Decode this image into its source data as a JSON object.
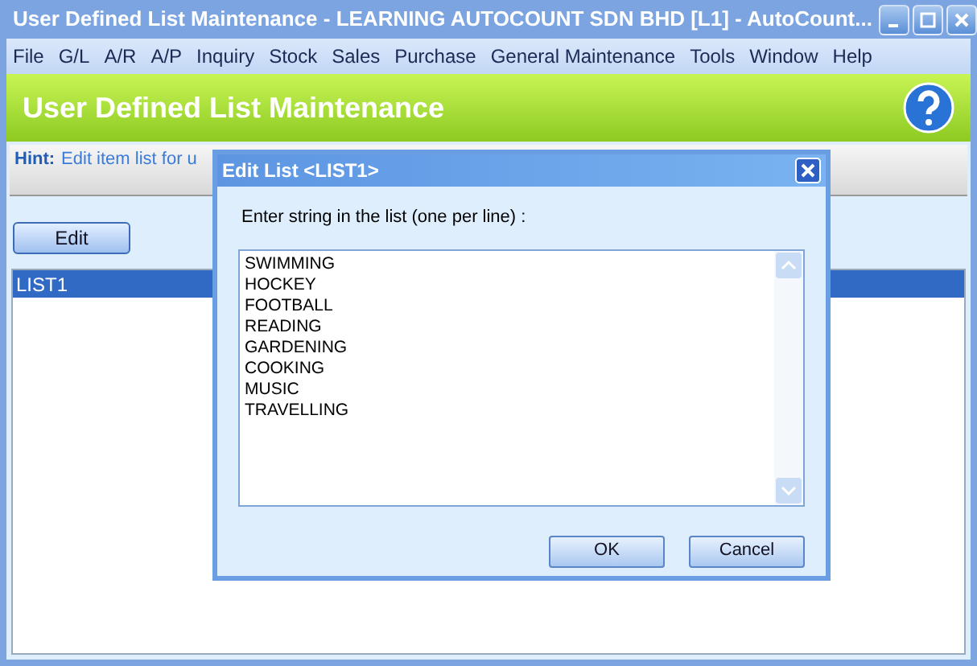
{
  "window": {
    "title": "User Defined List Maintenance - LEARNING AUTOCOUNT SDN BHD [L1] - AutoCount..."
  },
  "menu": [
    "File",
    "G/L",
    "A/R",
    "A/P",
    "Inquiry",
    "Stock",
    "Sales",
    "Purchase",
    "General Maintenance",
    "Tools",
    "Window",
    "Help"
  ],
  "header": {
    "title": "User Defined List Maintenance"
  },
  "hint": {
    "label": "Hint:",
    "text": "Edit item list for u"
  },
  "edit_button": "Edit",
  "lists": [
    {
      "name": "LIST1",
      "selected": true
    }
  ],
  "dialog": {
    "title": "Edit List <LIST1>",
    "prompt": "Enter string in the list (one per line) :",
    "lines": [
      "SWIMMING",
      "HOCKEY",
      "FOOTBALL",
      "READING",
      "GARDENING",
      "COOKING",
      "MUSIC",
      "TRAVELLING"
    ],
    "buttons": [
      "OK",
      "Cancel"
    ]
  }
}
